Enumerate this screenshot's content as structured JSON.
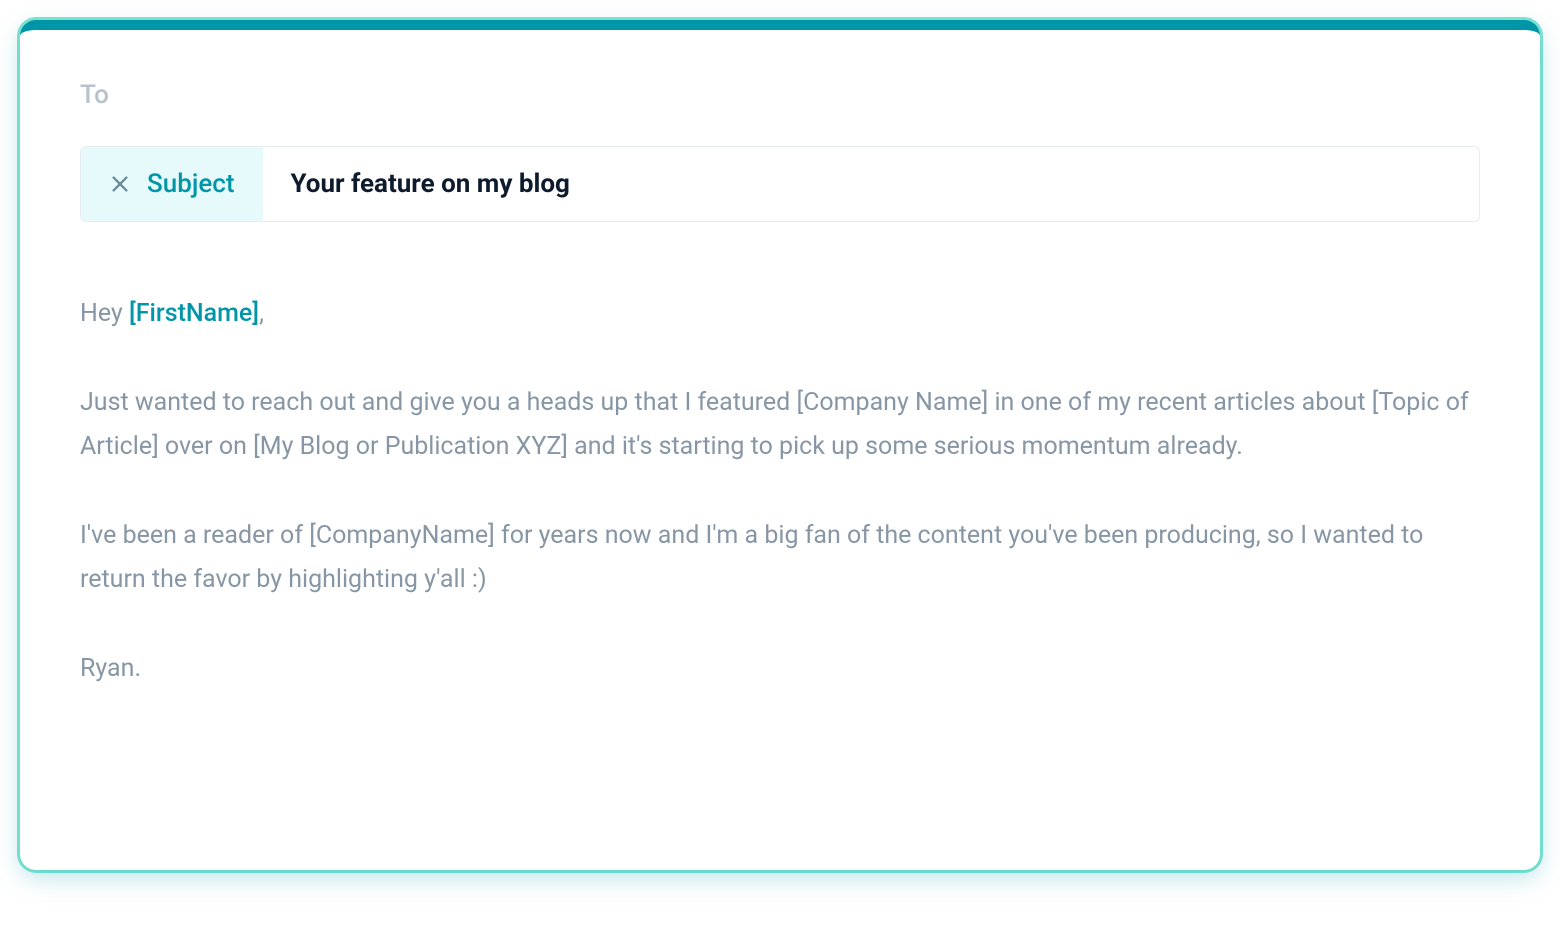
{
  "to": {
    "label": "To"
  },
  "subject": {
    "label": "Subject",
    "value": "Your feature on my blog"
  },
  "body": {
    "greeting_prefix": "Hey ",
    "greeting_token": "[FirstName]",
    "greeting_suffix": ",",
    "para1": "Just wanted to reach out and give you a heads up that I featured [Company Name] in one of my recent articles about [Topic of Article] over on [My Blog or Publication XYZ] and it's starting to pick up some serious momentum already.",
    "para2": "I've been a reader of [CompanyName] for years now and I'm a big fan of the content you've been producing, so I wanted to return the favor by highlighting y'all :)",
    "signature": "Ryan."
  }
}
